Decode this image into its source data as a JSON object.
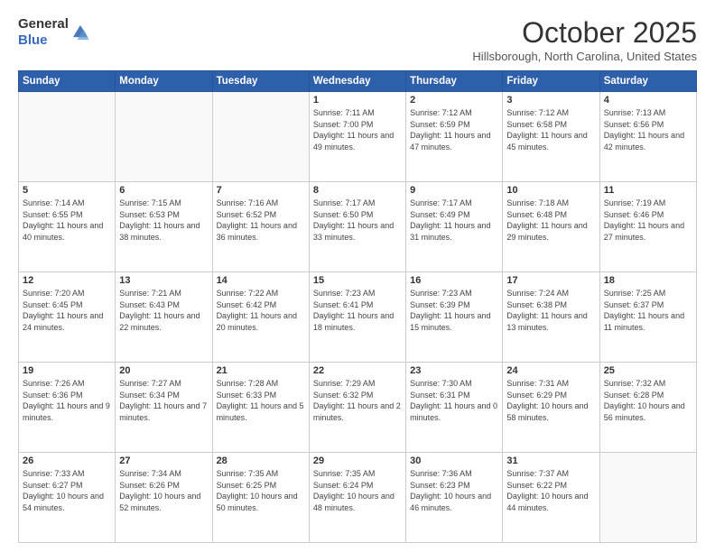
{
  "header": {
    "logo_general": "General",
    "logo_blue": "Blue",
    "month": "October 2025",
    "location": "Hillsborough, North Carolina, United States"
  },
  "days_of_week": [
    "Sunday",
    "Monday",
    "Tuesday",
    "Wednesday",
    "Thursday",
    "Friday",
    "Saturday"
  ],
  "weeks": [
    [
      {
        "day": "",
        "info": ""
      },
      {
        "day": "",
        "info": ""
      },
      {
        "day": "",
        "info": ""
      },
      {
        "day": "1",
        "info": "Sunrise: 7:11 AM\nSunset: 7:00 PM\nDaylight: 11 hours and 49 minutes."
      },
      {
        "day": "2",
        "info": "Sunrise: 7:12 AM\nSunset: 6:59 PM\nDaylight: 11 hours and 47 minutes."
      },
      {
        "day": "3",
        "info": "Sunrise: 7:12 AM\nSunset: 6:58 PM\nDaylight: 11 hours and 45 minutes."
      },
      {
        "day": "4",
        "info": "Sunrise: 7:13 AM\nSunset: 6:56 PM\nDaylight: 11 hours and 42 minutes."
      }
    ],
    [
      {
        "day": "5",
        "info": "Sunrise: 7:14 AM\nSunset: 6:55 PM\nDaylight: 11 hours and 40 minutes."
      },
      {
        "day": "6",
        "info": "Sunrise: 7:15 AM\nSunset: 6:53 PM\nDaylight: 11 hours and 38 minutes."
      },
      {
        "day": "7",
        "info": "Sunrise: 7:16 AM\nSunset: 6:52 PM\nDaylight: 11 hours and 36 minutes."
      },
      {
        "day": "8",
        "info": "Sunrise: 7:17 AM\nSunset: 6:50 PM\nDaylight: 11 hours and 33 minutes."
      },
      {
        "day": "9",
        "info": "Sunrise: 7:17 AM\nSunset: 6:49 PM\nDaylight: 11 hours and 31 minutes."
      },
      {
        "day": "10",
        "info": "Sunrise: 7:18 AM\nSunset: 6:48 PM\nDaylight: 11 hours and 29 minutes."
      },
      {
        "day": "11",
        "info": "Sunrise: 7:19 AM\nSunset: 6:46 PM\nDaylight: 11 hours and 27 minutes."
      }
    ],
    [
      {
        "day": "12",
        "info": "Sunrise: 7:20 AM\nSunset: 6:45 PM\nDaylight: 11 hours and 24 minutes."
      },
      {
        "day": "13",
        "info": "Sunrise: 7:21 AM\nSunset: 6:43 PM\nDaylight: 11 hours and 22 minutes."
      },
      {
        "day": "14",
        "info": "Sunrise: 7:22 AM\nSunset: 6:42 PM\nDaylight: 11 hours and 20 minutes."
      },
      {
        "day": "15",
        "info": "Sunrise: 7:23 AM\nSunset: 6:41 PM\nDaylight: 11 hours and 18 minutes."
      },
      {
        "day": "16",
        "info": "Sunrise: 7:23 AM\nSunset: 6:39 PM\nDaylight: 11 hours and 15 minutes."
      },
      {
        "day": "17",
        "info": "Sunrise: 7:24 AM\nSunset: 6:38 PM\nDaylight: 11 hours and 13 minutes."
      },
      {
        "day": "18",
        "info": "Sunrise: 7:25 AM\nSunset: 6:37 PM\nDaylight: 11 hours and 11 minutes."
      }
    ],
    [
      {
        "day": "19",
        "info": "Sunrise: 7:26 AM\nSunset: 6:36 PM\nDaylight: 11 hours and 9 minutes."
      },
      {
        "day": "20",
        "info": "Sunrise: 7:27 AM\nSunset: 6:34 PM\nDaylight: 11 hours and 7 minutes."
      },
      {
        "day": "21",
        "info": "Sunrise: 7:28 AM\nSunset: 6:33 PM\nDaylight: 11 hours and 5 minutes."
      },
      {
        "day": "22",
        "info": "Sunrise: 7:29 AM\nSunset: 6:32 PM\nDaylight: 11 hours and 2 minutes."
      },
      {
        "day": "23",
        "info": "Sunrise: 7:30 AM\nSunset: 6:31 PM\nDaylight: 11 hours and 0 minutes."
      },
      {
        "day": "24",
        "info": "Sunrise: 7:31 AM\nSunset: 6:29 PM\nDaylight: 10 hours and 58 minutes."
      },
      {
        "day": "25",
        "info": "Sunrise: 7:32 AM\nSunset: 6:28 PM\nDaylight: 10 hours and 56 minutes."
      }
    ],
    [
      {
        "day": "26",
        "info": "Sunrise: 7:33 AM\nSunset: 6:27 PM\nDaylight: 10 hours and 54 minutes."
      },
      {
        "day": "27",
        "info": "Sunrise: 7:34 AM\nSunset: 6:26 PM\nDaylight: 10 hours and 52 minutes."
      },
      {
        "day": "28",
        "info": "Sunrise: 7:35 AM\nSunset: 6:25 PM\nDaylight: 10 hours and 50 minutes."
      },
      {
        "day": "29",
        "info": "Sunrise: 7:35 AM\nSunset: 6:24 PM\nDaylight: 10 hours and 48 minutes."
      },
      {
        "day": "30",
        "info": "Sunrise: 7:36 AM\nSunset: 6:23 PM\nDaylight: 10 hours and 46 minutes."
      },
      {
        "day": "31",
        "info": "Sunrise: 7:37 AM\nSunset: 6:22 PM\nDaylight: 10 hours and 44 minutes."
      },
      {
        "day": "",
        "info": ""
      }
    ]
  ]
}
